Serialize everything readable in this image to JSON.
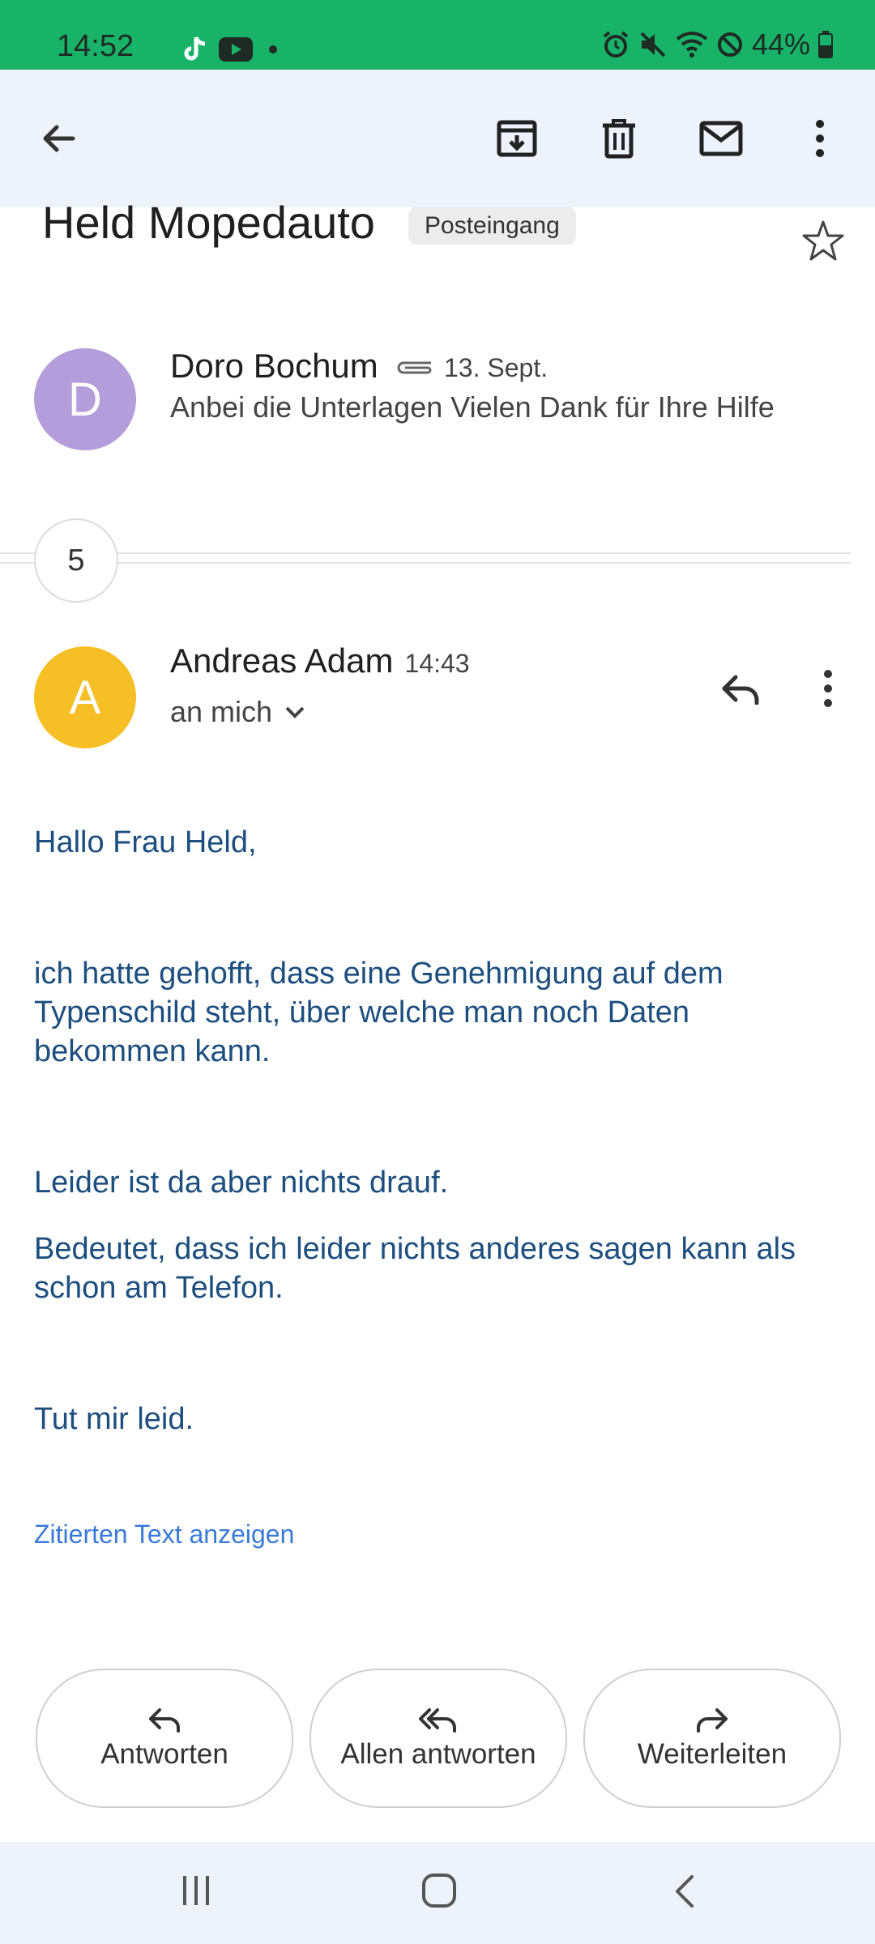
{
  "status_bar": {
    "time": "14:52",
    "battery": "44%",
    "left_icons": [
      "tiktok-icon",
      "youtube-icon",
      "dot-icon"
    ],
    "right_icons": [
      "alarm-icon",
      "mute-icon",
      "wifi-icon",
      "dnd-icon",
      "battery-icon"
    ]
  },
  "toolbar": {
    "back": "back-arrow-icon",
    "actions": [
      "archive-icon",
      "trash-icon",
      "mark-unread-icon",
      "more-vert-icon"
    ]
  },
  "thread": {
    "subject": "Held Mopedauto",
    "label": "Posteingang",
    "hidden_count": "5"
  },
  "first_message": {
    "avatar_letter": "D",
    "avatar_color": "#b39ddb",
    "sender": "Doro Bochum",
    "date": "13. Sept.",
    "snippet": "Anbei die Unterlagen Vielen Dank für Ihre Hilfe"
  },
  "latest_message": {
    "avatar_letter": "A",
    "avatar_color": "#f6bf26",
    "sender": "Andreas Adam",
    "time": "14:43",
    "recipient": "an mich",
    "body": {
      "greeting": "Hallo Frau Held,",
      "p1": "ich hatte gehofft, dass eine Genehmigung auf dem Typenschild steht, über welche man noch Daten bekommen kann.",
      "p2": "Leider ist da aber nichts drauf.",
      "p3": "Bedeutet, dass ich leider nichts anderes sagen kann als schon am Telefon.",
      "p4": "Tut mir leid."
    },
    "show_quoted": "Zitierten Text anzeigen"
  },
  "actions": {
    "reply": "Antworten",
    "reply_all": "Allen antworten",
    "forward": "Weiterleiten"
  },
  "colors": {
    "status_bar": "#18b368",
    "app_bar": "#eef2fa",
    "body_text": "#1d4e7f",
    "link": "#3a7ad9"
  }
}
